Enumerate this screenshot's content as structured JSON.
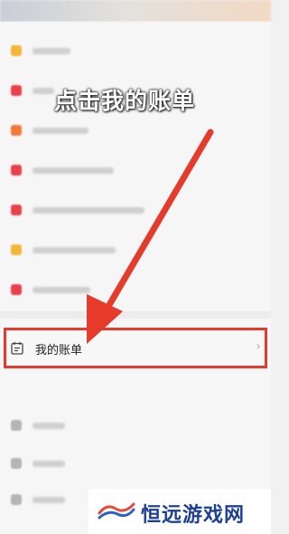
{
  "menu": {
    "highlighted_item": {
      "label": "我的账单",
      "icon": "calendar-bill-icon",
      "chevron": "›"
    },
    "blurred_item_icon_colors": [
      "#f3b53a",
      "#e8414b",
      "#f07a3c",
      "#e8414b",
      "#e8414b",
      "#f3b53a",
      "#e8414b",
      "#b5b5b5",
      "#b5b5b5",
      "#b5b5b5",
      "#b5b5b5",
      "#b5b5b5"
    ]
  },
  "annotation": {
    "callout_text": "点击我的账单",
    "arrow_color": "#e63a2a",
    "highlight_color": "#e63a2a"
  },
  "watermark": {
    "text": "恒远游戏网"
  }
}
